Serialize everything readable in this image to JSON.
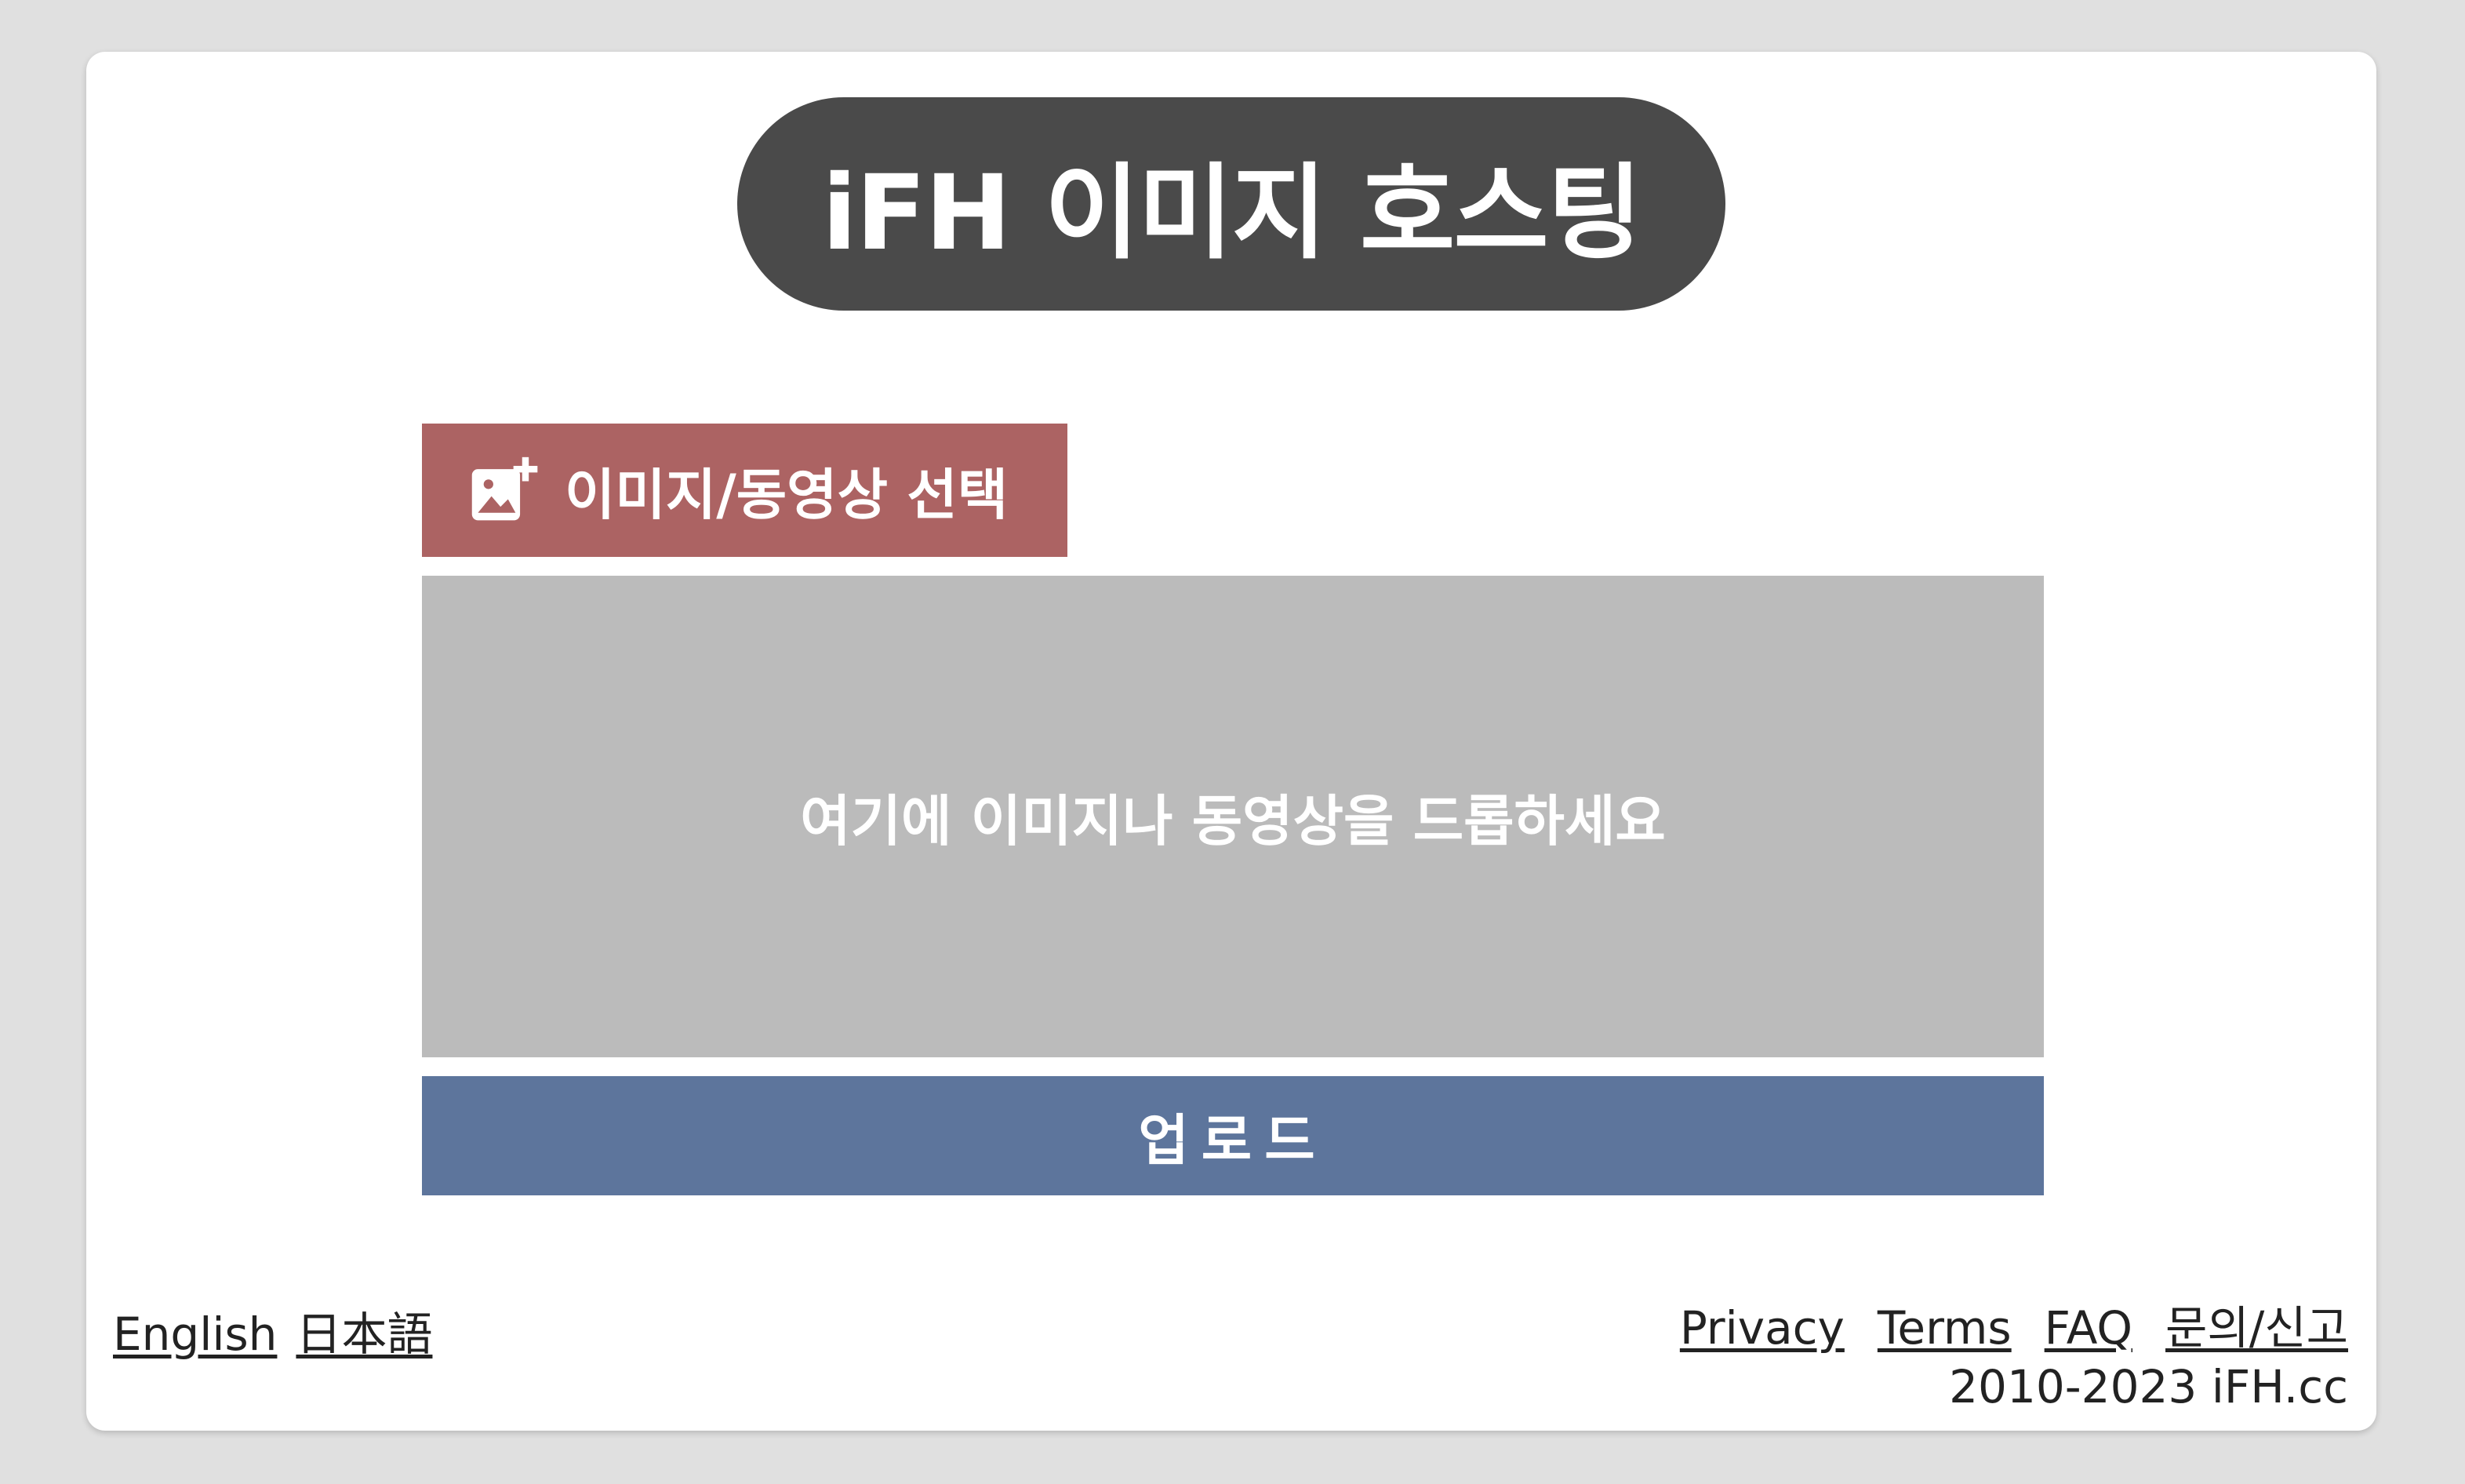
{
  "header": {
    "logo_text": "iFH 이미지 호스팅"
  },
  "uploader": {
    "select_label": "이미지/동영상 선택",
    "select_icon": "add-photo-icon",
    "drop_text": "여기에 이미지나 동영상을 드롭하세요",
    "upload_label": "업로드"
  },
  "footer": {
    "languages": [
      {
        "label": "English"
      },
      {
        "label": "日本語"
      }
    ],
    "links": [
      {
        "label": "Privacy"
      },
      {
        "label": "Terms"
      },
      {
        "label": "FAQ"
      },
      {
        "label": "문의/신고"
      }
    ],
    "copyright": "2010-2023 iFH.cc"
  },
  "colors": {
    "page_bg": "#e0e0e0",
    "logo_bg": "#4a4a4a",
    "select_button": "#ac6363",
    "drop_zone": "#bbbbbb",
    "upload_button": "#5d759c"
  }
}
